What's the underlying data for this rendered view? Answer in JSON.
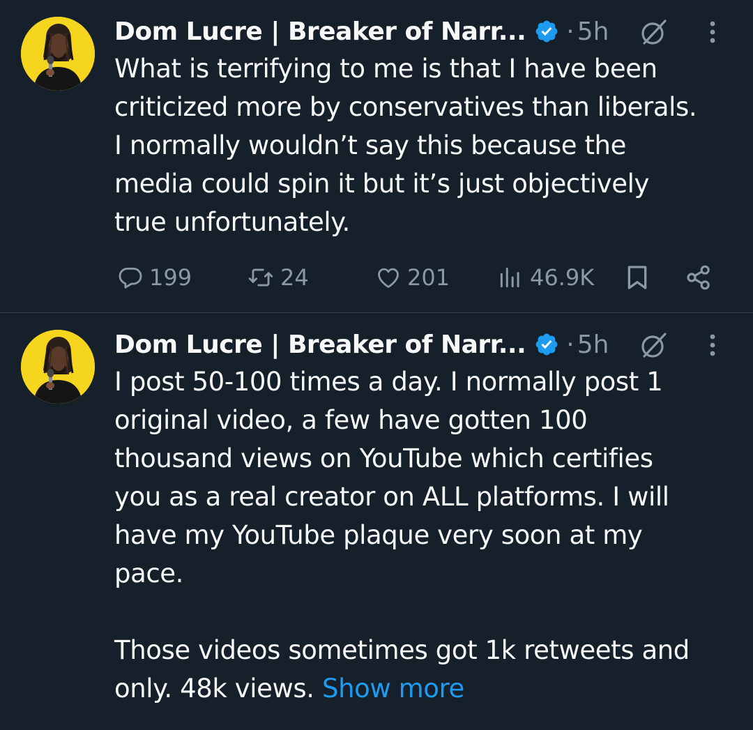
{
  "tweets": [
    {
      "author": "Dom Lucre | Breaker of Narr...",
      "separator": "·",
      "time": "5h",
      "text": "What is terrifying to me is that I have been\ncriticized more by conservatives than liberals.\nI normally wouldn’t say this because the\nmedia could spin it but it’s just objectively\ntrue unfortunately.",
      "replies": "199",
      "retweets": "24",
      "likes": "201",
      "views": "46.9K"
    },
    {
      "author": "Dom Lucre | Breaker of Narr...",
      "separator": "·",
      "time": "5h",
      "text": "I post 50-100 times a day. I normally post 1\noriginal video, a few have gotten 100\nthousand views on YouTube which certifies\nyou as a real creator on ALL platforms. I will\nhave my YouTube plaque very soon at my\npace.\n\nThose videos sometimes got 1k retweets and\nonly. 48k views. ",
      "show_more": "Show more"
    }
  ],
  "colors": {
    "background": "#15202b",
    "text": "#f7f9f9",
    "muted": "#8b98a5",
    "accent": "#1d9bf0",
    "divider": "#38444d",
    "avatar_bg": "#f6d51f"
  },
  "icons": [
    "verified-badge-icon",
    "grok-icon",
    "more-options-icon",
    "reply-icon",
    "retweet-icon",
    "like-icon",
    "views-icon",
    "bookmark-icon",
    "share-icon"
  ]
}
